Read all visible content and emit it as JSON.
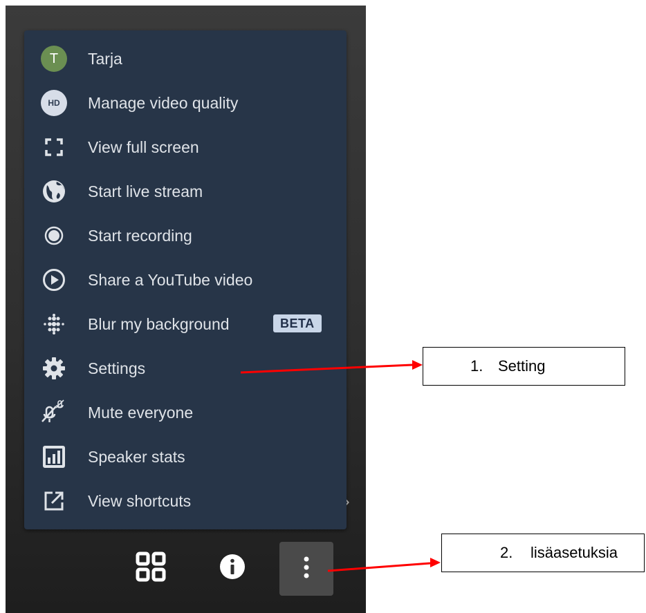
{
  "menu": {
    "items": [
      {
        "label": "Tarja",
        "icon": "avatar-icon",
        "avatar_initial": "T"
      },
      {
        "label": "Manage video quality",
        "icon": "hd-icon",
        "badge": "HD"
      },
      {
        "label": "View full screen",
        "icon": "fullscreen-icon"
      },
      {
        "label": "Start live stream",
        "icon": "globe-icon"
      },
      {
        "label": "Start recording",
        "icon": "record-icon"
      },
      {
        "label": "Share a YouTube video",
        "icon": "play-circle-icon"
      },
      {
        "label": "Blur my background",
        "icon": "blur-icon",
        "tag": "BETA"
      },
      {
        "label": "Settings",
        "icon": "gear-icon"
      },
      {
        "label": "Mute everyone",
        "icon": "mic-muted-icon"
      },
      {
        "label": "Speaker stats",
        "icon": "bar-chart-icon"
      },
      {
        "label": "View shortcuts",
        "icon": "external-link-icon"
      }
    ]
  },
  "toolbar": {
    "buttons": [
      {
        "icon": "tile-view-icon"
      },
      {
        "icon": "info-icon"
      },
      {
        "icon": "more-vertical-icon",
        "active": true
      }
    ]
  },
  "annotations": {
    "callout1": {
      "number": "1.",
      "text": "Setting"
    },
    "callout2": {
      "number": "2.",
      "text": "lisäasetuksia"
    },
    "arrow_color": "#ff0000"
  },
  "colors": {
    "menu_bg": "#273548",
    "menu_text": "#dfe3e8",
    "avatar_bg": "#6b8f52"
  }
}
